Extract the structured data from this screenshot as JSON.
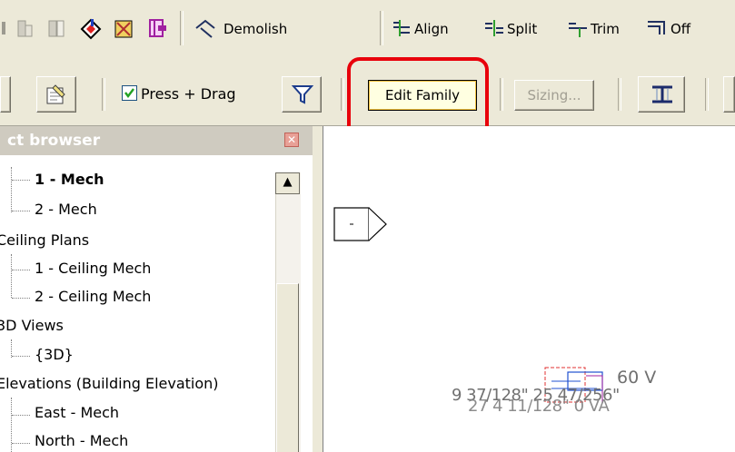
{
  "toolbar_top": {
    "demolish_label": "Demolish",
    "align_label": "Align",
    "split_label": "Split",
    "trim_label": "Trim",
    "offset_label": "Off"
  },
  "toolbar_second": {
    "press_drag_label": "Press + Drag",
    "press_drag_checked": true,
    "edit_family_label": "Edit Family",
    "sizing_label": "Sizing..."
  },
  "project_browser": {
    "title": "ct browser",
    "items": [
      {
        "label": "1 - Mech",
        "bold": true
      },
      {
        "label": "2 - Mech"
      },
      {
        "label": "Ceiling Plans"
      },
      {
        "label": "1 - Ceiling Mech"
      },
      {
        "label": "2 - Ceiling Mech"
      },
      {
        "label": "3D Views"
      },
      {
        "label": "{3D}"
      },
      {
        "label": "Elevations (Building Elevation)"
      },
      {
        "label": "East - Mech"
      },
      {
        "label": "North - Mech"
      }
    ]
  },
  "canvas": {
    "tag_line_1": "60 V",
    "tag_line_2": "9 37/128\" 25 47/256\"",
    "tag_line_3": "27 4 11/128\" 0 VA"
  },
  "colors": {
    "highlight_ring": "#e8000b",
    "toolbar_bg": "#ece9d8",
    "edit_family_bg": "#ffffe1"
  }
}
